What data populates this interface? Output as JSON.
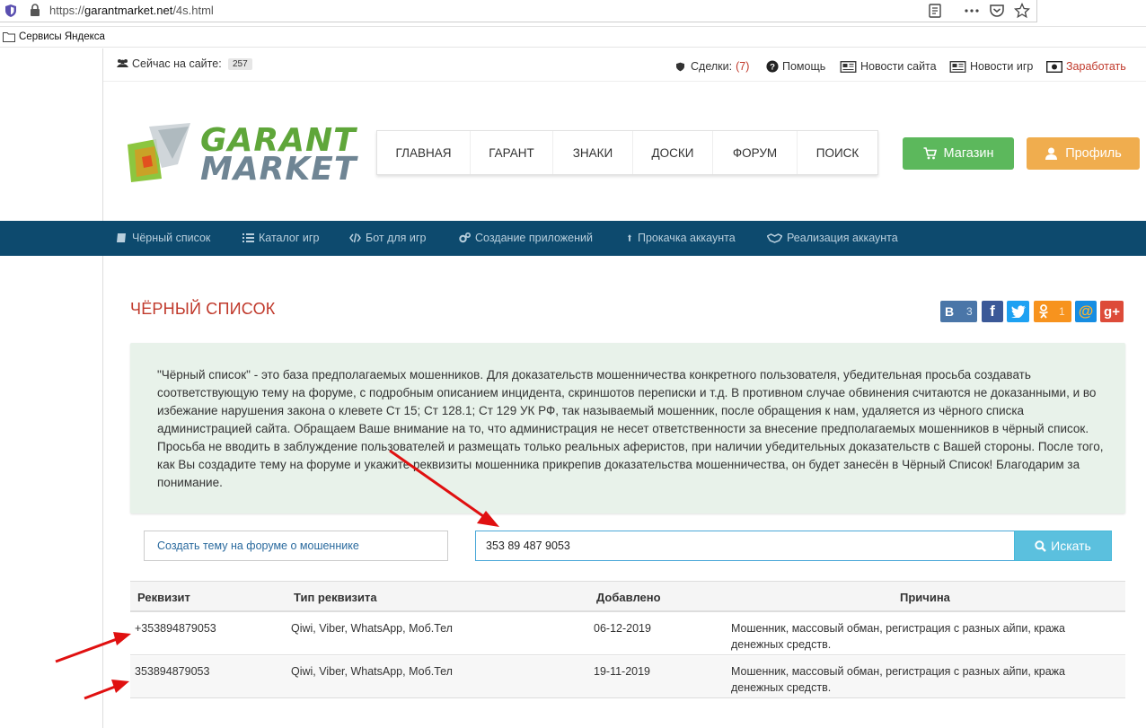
{
  "browser": {
    "url_prefix": "https://",
    "url_host": "garantmarket.net",
    "url_path": "/4s.html",
    "bookmark": "Сервисы Яндекса"
  },
  "topbar": {
    "online_label": "Сейчас на сайте:",
    "online_count": "257",
    "deals_label": "Сделки:",
    "deals_count": "(7)",
    "help": "Помощь",
    "site_news": "Новости сайта",
    "game_news": "Новости игр",
    "earn": "Заработать"
  },
  "logo": {
    "line1": "GARANT",
    "line2": "MARKET"
  },
  "main_nav": [
    "ГЛАВНАЯ",
    "ГАРАНТ",
    "ЗНАКИ",
    "ДОСКИ",
    "ФОРУМ",
    "ПОИСК"
  ],
  "buttons": {
    "shop": "Магазин",
    "profile": "Профиль"
  },
  "sub_nav": [
    "Чёрный список",
    "Каталог игр",
    "Бот для игр",
    "Создание приложений",
    "Прокачка аккаунта",
    "Реализация аккаунта"
  ],
  "page_title": "ЧЁРНЫЙ СПИСОК",
  "social": {
    "vk_count": "3",
    "ok_count": "1"
  },
  "info_text": "\"Чёрный список\" - это база предполагаемых мошенников. Для доказательств мошенничества конкретного пользователя, убедительная просьба создавать соответствующую тему на форуме, с подробным описанием инцидента, скриншотов переписки и т.д. В противном случае обвинения считаются не доказанными, и во избежание нарушения закона о клевете Ст 15; Ст 128.1; Ст 129 УК РФ, так называемый мошенник, после обращения к нам, удаляется из чёрного списка администрацией сайта. Обращаем Ваше внимание на то, что администрация не несет ответственности за внесение предполагаемых мошенников в чёрный список. Просьба не вводить в заблуждение пользователей и размещать только реальных аферистов, при наличии убедительных доказательств с Вашей стороны. После того, как Вы создадите тему на форуме и укажите реквизиты мошенника прикрепив доказательства мошенничества, он будет занесён в Чёрный Список! Благодарим за понимание.",
  "create_topic": "Создать тему на форуме о мошеннике",
  "search": {
    "value": "353 89 487 9053",
    "button": "Искать"
  },
  "table": {
    "headers": [
      "Реквизит",
      "Тип реквизита",
      "Добавлено",
      "Причина"
    ],
    "rows": [
      {
        "requisite": "+353894879053",
        "type": "Qiwi, Viber, WhatsApp, Моб.Тел",
        "added": "06-12-2019",
        "reason": "Мошенник, массовый обман, регистрация с разных айпи, кража денежных средств."
      },
      {
        "requisite": "353894879053",
        "type": "Qiwi, Viber, WhatsApp, Моб.Тел",
        "added": "19-11-2019",
        "reason": "Мошенник, массовый обман, регистрация с разных айпи, кража денежных средств."
      }
    ]
  },
  "colors": {
    "accent_red": "#c0392b",
    "nav_blue": "#0d4a6e",
    "shop_green": "#5cb85c",
    "profile_orange": "#f0ad4e",
    "search_blue": "#5bc0de"
  }
}
